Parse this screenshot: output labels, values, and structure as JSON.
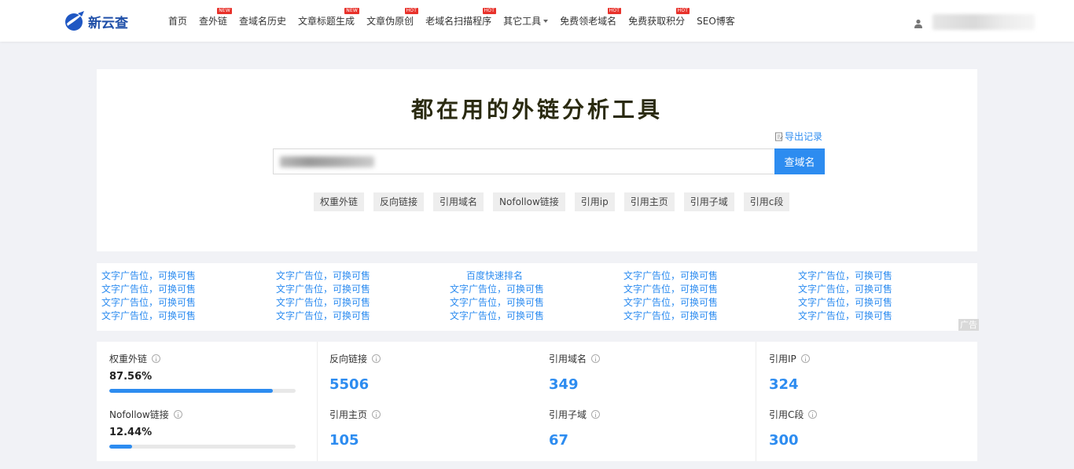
{
  "brand": {
    "name": "新云查"
  },
  "nav": {
    "items": [
      {
        "label": "首页",
        "badge": ""
      },
      {
        "label": "查外链",
        "badge": "NEW"
      },
      {
        "label": "查域名历史",
        "badge": ""
      },
      {
        "label": "文章标题生成",
        "badge": "NEW"
      },
      {
        "label": "文章伪原创",
        "badge": "HOT"
      },
      {
        "label": "老域名扫描程序",
        "badge": "HOT"
      },
      {
        "label": "其它工具",
        "badge": ""
      },
      {
        "label": "免费领老域名",
        "badge": "HOT"
      },
      {
        "label": "免费获取积分",
        "badge": "HOT"
      },
      {
        "label": "SEO博客",
        "badge": ""
      }
    ]
  },
  "search": {
    "title": "都在用的外链分析工具",
    "export_label": "导出记录",
    "button_label": "查域名",
    "tags": [
      "权重外链",
      "反向链接",
      "引用域名",
      "Nofollow链接",
      "引用ip",
      "引用主页",
      "引用子域",
      "引用c段"
    ]
  },
  "ads": {
    "columns": [
      [
        "文字广告位，可换可售",
        "文字广告位，可换可售",
        "文字广告位，可换可售",
        "文字广告位，可换可售"
      ],
      [
        "文字广告位，可换可售",
        "文字广告位，可换可售",
        "文字广告位，可换可售",
        "文字广告位，可换可售"
      ],
      [
        "百度快速排名",
        "文字广告位，可换可售",
        "文字广告位，可换可售",
        "文字广告位，可换可售"
      ],
      [
        "文字广告位，可换可售",
        "文字广告位，可换可售",
        "文字广告位，可换可售",
        "文字广告位，可换可售"
      ],
      [
        "文字广告位，可换可售",
        "文字广告位，可换可售",
        "文字广告位，可换可售",
        "文字广告位，可换可售"
      ]
    ],
    "label": "广告"
  },
  "stats": {
    "weight_links": {
      "label": "权重外链",
      "value": "87.56%",
      "fraction": 0.8756
    },
    "nofollow_links": {
      "label": "Nofollow链接",
      "value": "12.44%",
      "fraction": 0.1244
    },
    "backlinks": {
      "label": "反向链接",
      "value": "5506"
    },
    "ref_domains": {
      "label": "引用域名",
      "value": "349"
    },
    "ref_ip": {
      "label": "引用IP",
      "value": "324"
    },
    "ref_pages": {
      "label": "引用主页",
      "value": "105"
    },
    "ref_subdomains": {
      "label": "引用子域",
      "value": "67"
    },
    "ref_c_segment": {
      "label": "引用C段",
      "value": "300"
    }
  },
  "colors": {
    "accent": "#2d8cf0",
    "badge": "#e8322b",
    "brand": "#1f4fa8"
  }
}
